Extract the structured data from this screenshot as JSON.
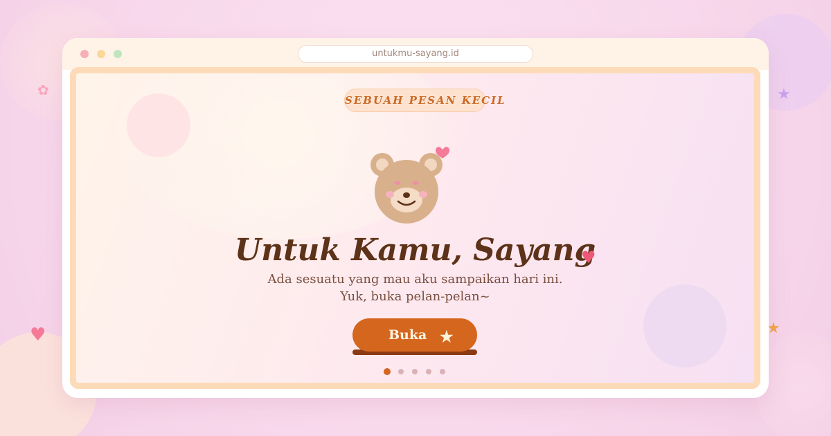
{
  "browser": {
    "url": "untukmu-sayang.id"
  },
  "card": {
    "tag": "SEBUAH PESAN KECIL",
    "title": "Untuk Kamu, Sayang",
    "subtitle_line1": "Ada sesuatu yang mau aku sampaikan hari ini.",
    "subtitle_line2": "Yuk, buka pelan-pelan~",
    "button_label": "Buka",
    "pagination": {
      "total": 5,
      "current": 1
    }
  },
  "icons": {
    "bear": "teddy-bear-icon",
    "heart": "heart-icon",
    "star": "star-icon",
    "sparkle": "sparkle-icon"
  },
  "colors": {
    "accent": "#d4661e",
    "heart": "#ee5876",
    "frame": "#fddbb8",
    "bear": "#d8b08c"
  }
}
